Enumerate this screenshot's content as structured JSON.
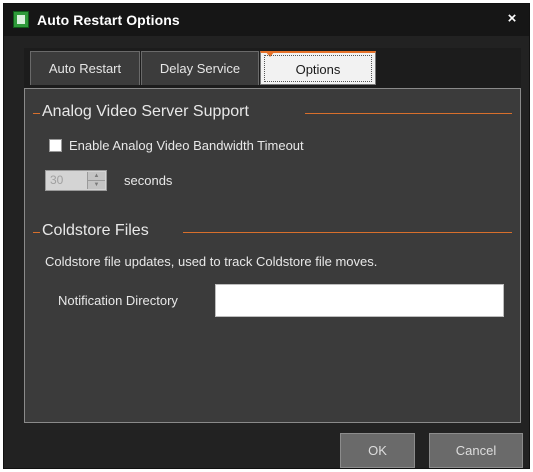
{
  "window": {
    "title": "Auto Restart Options",
    "close_glyph": "×",
    "icon": "app-options-icon"
  },
  "tabs": [
    {
      "label": "Auto Restart",
      "active": false
    },
    {
      "label": "Delay Service",
      "active": false
    },
    {
      "label": "Options",
      "active": true
    }
  ],
  "analog": {
    "heading": "Analog Video Server Support",
    "checkbox_label": "Enable Analog Video Bandwidth Timeout",
    "checked": false,
    "timeout_value": "30",
    "timeout_unit": "seconds"
  },
  "coldstore": {
    "heading": "Coldstore Files",
    "description": "Coldstore file updates, used to track Coldstore file moves.",
    "dir_label": "Notification Directory",
    "dir_value": ""
  },
  "buttons": {
    "ok": "OK",
    "cancel": "Cancel"
  },
  "colors": {
    "accent": "#e6722a",
    "background": "#222222",
    "panel": "#3b3b3b"
  }
}
